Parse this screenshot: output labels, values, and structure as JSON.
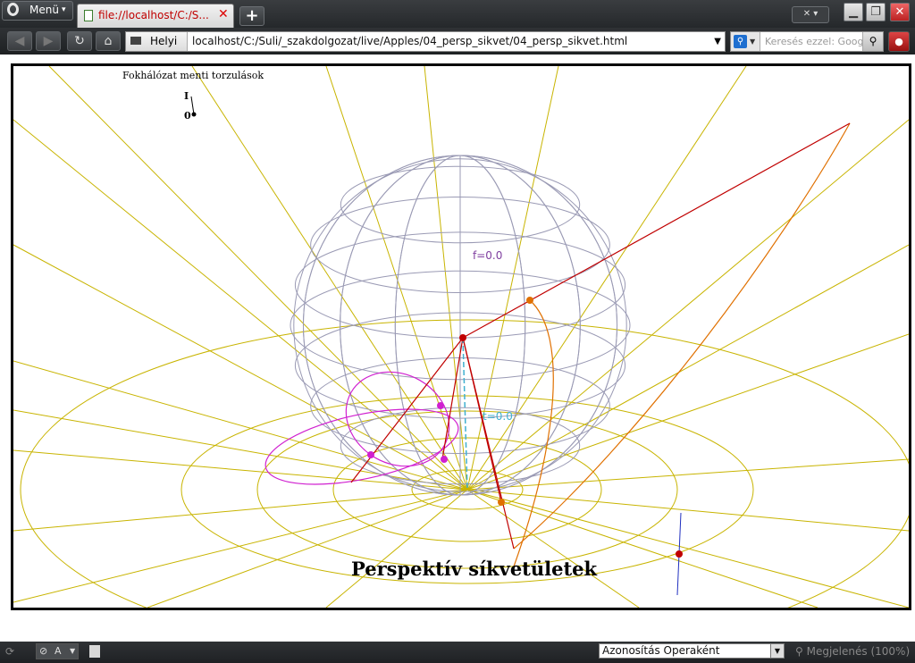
{
  "browser": {
    "menu_label": "Menü",
    "tab_title": "file://localhost/C:/S...",
    "address_site_label": "Helyi",
    "url": "localhost/C:/Suli/_szakdolgozat/live/Apples/04_persp_sikvet/04_persp_sikvet.html",
    "search_placeholder": "Keresés ezzel: Google"
  },
  "applet": {
    "caption": "Fokhálózat menti torzulások",
    "slider_label_top": "I",
    "slider_label_bottom": "0",
    "f_label": "f=0.0",
    "t_label": "t=0.0",
    "title": "Perspektív síkvetületek",
    "colors": {
      "grid": "#c8b400",
      "sphere": "#9a9ab4",
      "red": "#c00000",
      "orange": "#e07000",
      "magenta": "#d020d0",
      "cyan": "#40b0d0",
      "blue": "#2030c0"
    }
  },
  "statusbar": {
    "identify_as": "Azonosítás Operaként",
    "zoom": "Megjelenés (100%)",
    "encoding_short": "A"
  }
}
